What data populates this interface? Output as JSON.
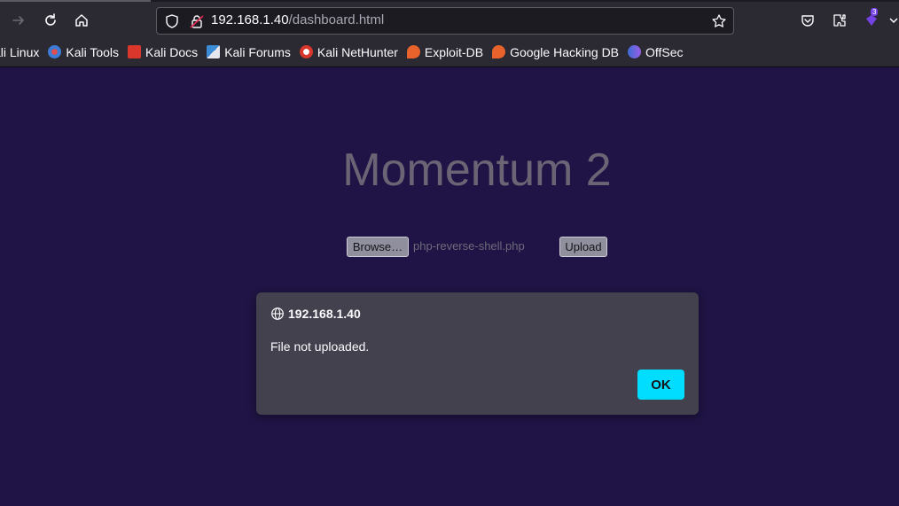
{
  "browser": {
    "url_host": "192.168.1.40",
    "url_path": "/dashboard.html",
    "extension_badge": "3"
  },
  "bookmarks": [
    {
      "label": "ali Linux",
      "icon": "kali-linux-icon"
    },
    {
      "label": "Kali Tools",
      "icon": "kali-tools-icon"
    },
    {
      "label": "Kali Docs",
      "icon": "kali-docs-icon"
    },
    {
      "label": "Kali Forums",
      "icon": "kali-forums-icon"
    },
    {
      "label": "Kali NetHunter",
      "icon": "kali-nethunter-icon"
    },
    {
      "label": "Exploit-DB",
      "icon": "exploit-db-icon"
    },
    {
      "label": "Google Hacking DB",
      "icon": "google-hacking-db-icon"
    },
    {
      "label": "OffSec",
      "icon": "offsec-icon"
    }
  ],
  "page": {
    "title": "Momentum 2",
    "browse_label": "Browse…",
    "file_name": "php-reverse-shell.php",
    "upload_label": "Upload"
  },
  "dialog": {
    "origin": "192.168.1.40",
    "message": "File not uploaded.",
    "ok_label": "OK"
  },
  "colors": {
    "page_bg": "#1f1445",
    "toolbar_bg": "#2b2a33",
    "dialog_bg": "#42414d",
    "accent": "#00ddff"
  }
}
